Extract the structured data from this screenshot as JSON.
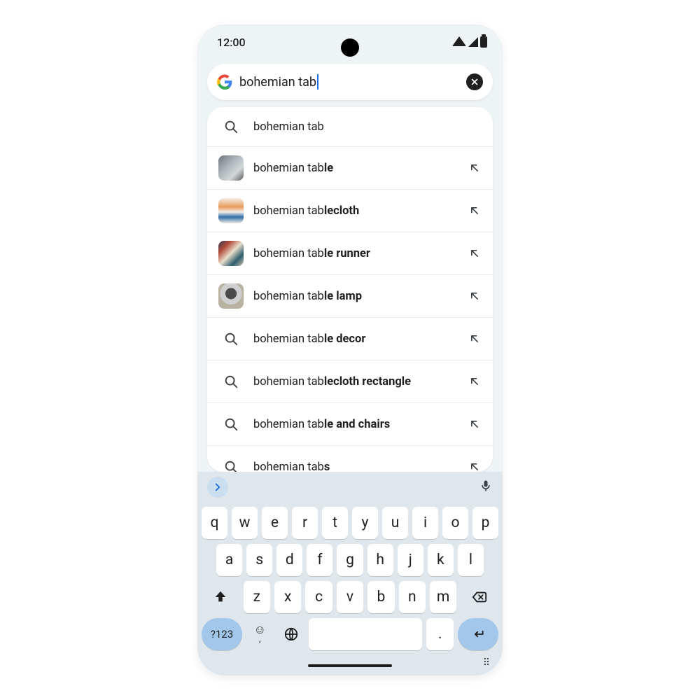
{
  "status": {
    "time": "12:00"
  },
  "search": {
    "query": "bohemian tab",
    "clear_label": "Clear"
  },
  "suggestions": [
    {
      "icon": "search",
      "prefix": "bohemian tab",
      "bold": "",
      "has_insert": false
    },
    {
      "icon": "thumb1",
      "prefix": "bohemian tab",
      "bold": "le",
      "has_insert": true
    },
    {
      "icon": "thumb2",
      "prefix": "bohemian tab",
      "bold": "lecloth",
      "has_insert": true
    },
    {
      "icon": "thumb3",
      "prefix": "bohemian tab",
      "bold": "le runner",
      "has_insert": true
    },
    {
      "icon": "thumb4",
      "prefix": "bohemian tab",
      "bold": "le lamp",
      "has_insert": true
    },
    {
      "icon": "search",
      "prefix": "bohemian tab",
      "bold": "le decor",
      "has_insert": true
    },
    {
      "icon": "search",
      "prefix": "bohemian tab",
      "bold": "lecloth rectangle",
      "has_insert": true
    },
    {
      "icon": "search",
      "prefix": "bohemian tab",
      "bold": "le and chairs",
      "has_insert": true
    },
    {
      "icon": "search",
      "prefix": "bohemian tab",
      "bold": "s",
      "has_insert": true
    }
  ],
  "keyboard": {
    "row1": [
      "q",
      "w",
      "e",
      "r",
      "t",
      "y",
      "u",
      "i",
      "o",
      "p"
    ],
    "row2": [
      "a",
      "s",
      "d",
      "f",
      "g",
      "h",
      "j",
      "k",
      "l"
    ],
    "row3": [
      "z",
      "x",
      "c",
      "v",
      "b",
      "n",
      "m"
    ],
    "symbols_key": "?123",
    "period_key": ".",
    "comma_key": ","
  }
}
